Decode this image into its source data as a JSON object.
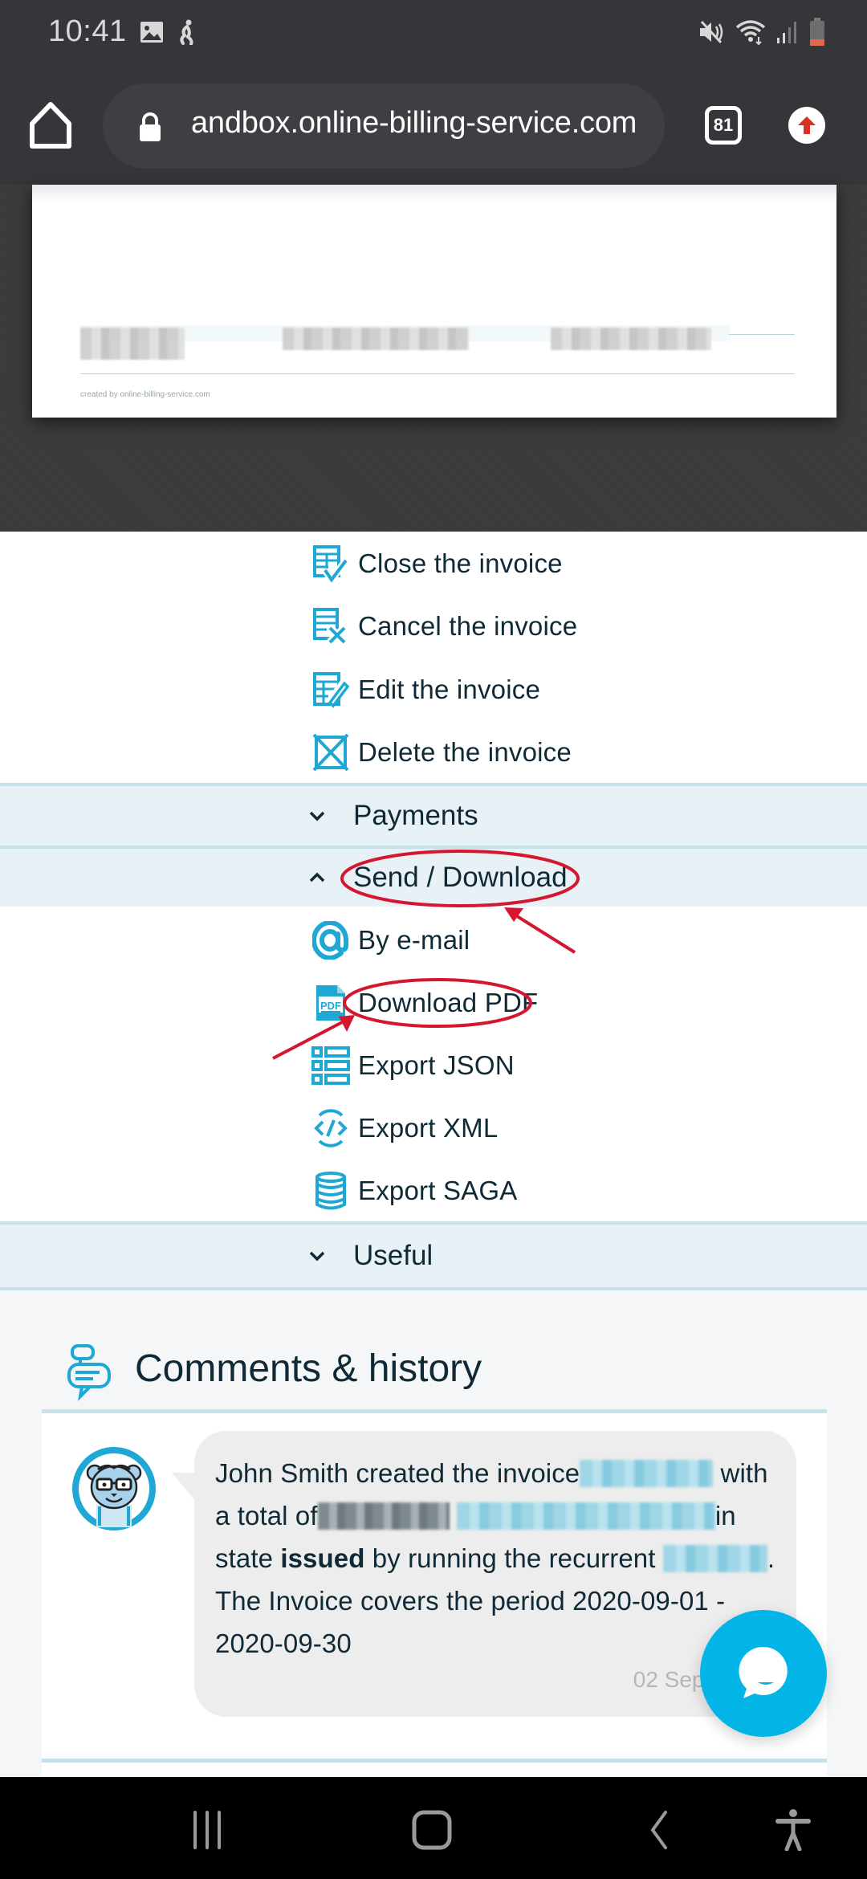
{
  "status_bar": {
    "time": "10:41",
    "left_icons": [
      "gallery-icon",
      "accessibility-running-icon"
    ],
    "right_icons": [
      "mute-icon",
      "wifi-icon",
      "signal-icon",
      "battery-low-icon"
    ]
  },
  "browser": {
    "url": "andbox.online-billing-service.com",
    "tab_count": "81",
    "icons": [
      "home-icon",
      "lock-icon",
      "tab-switcher-icon",
      "update-arrow-icon"
    ]
  },
  "invoice_preview": {
    "credit": "created by online-billing-service.com"
  },
  "actions": [
    {
      "label": "Close the invoice",
      "icon": "invoice-check-icon"
    },
    {
      "label": "Cancel the invoice",
      "icon": "invoice-cancel-icon"
    },
    {
      "label": "Edit the invoice",
      "icon": "invoice-edit-icon"
    },
    {
      "label": "Delete the invoice",
      "icon": "delete-box-icon"
    }
  ],
  "sections": {
    "payments": {
      "label": "Payments",
      "state": "collapsed"
    },
    "send_download": {
      "label": "Send / Download",
      "state": "expanded",
      "items": [
        {
          "label": "By e-mail",
          "icon": "at-sign-icon"
        },
        {
          "label": "Download PDF",
          "icon": "pdf-file-icon"
        },
        {
          "label": "Export JSON",
          "icon": "list-icon"
        },
        {
          "label": "Export XML",
          "icon": "code-icon"
        },
        {
          "label": "Export SAGA",
          "icon": "database-icon"
        }
      ]
    },
    "useful": {
      "label": "Useful",
      "state": "collapsed"
    }
  },
  "comments": {
    "title": "Comments & history",
    "entries": [
      {
        "author_line": "John Smith created the invoice",
        "text_with": "with",
        "text_total": "a total of",
        "text_in": "in",
        "text_state": "state",
        "state_value": "issued",
        "text_running": "by running the recurrent",
        "text_period": "The Invoice covers the period 2020-09-01 - 2020-09-30",
        "date": "02 Sep 202"
      }
    ]
  },
  "annotations": {
    "color": "#d4162f",
    "highlighted": [
      "Send / Download",
      "Download PDF"
    ]
  },
  "colors": {
    "accent": "#1fa8d4",
    "fab": "#03b5e6",
    "band": "#e8f1f6",
    "band_border": "#c6e0ec",
    "text": "#0f2a36"
  }
}
